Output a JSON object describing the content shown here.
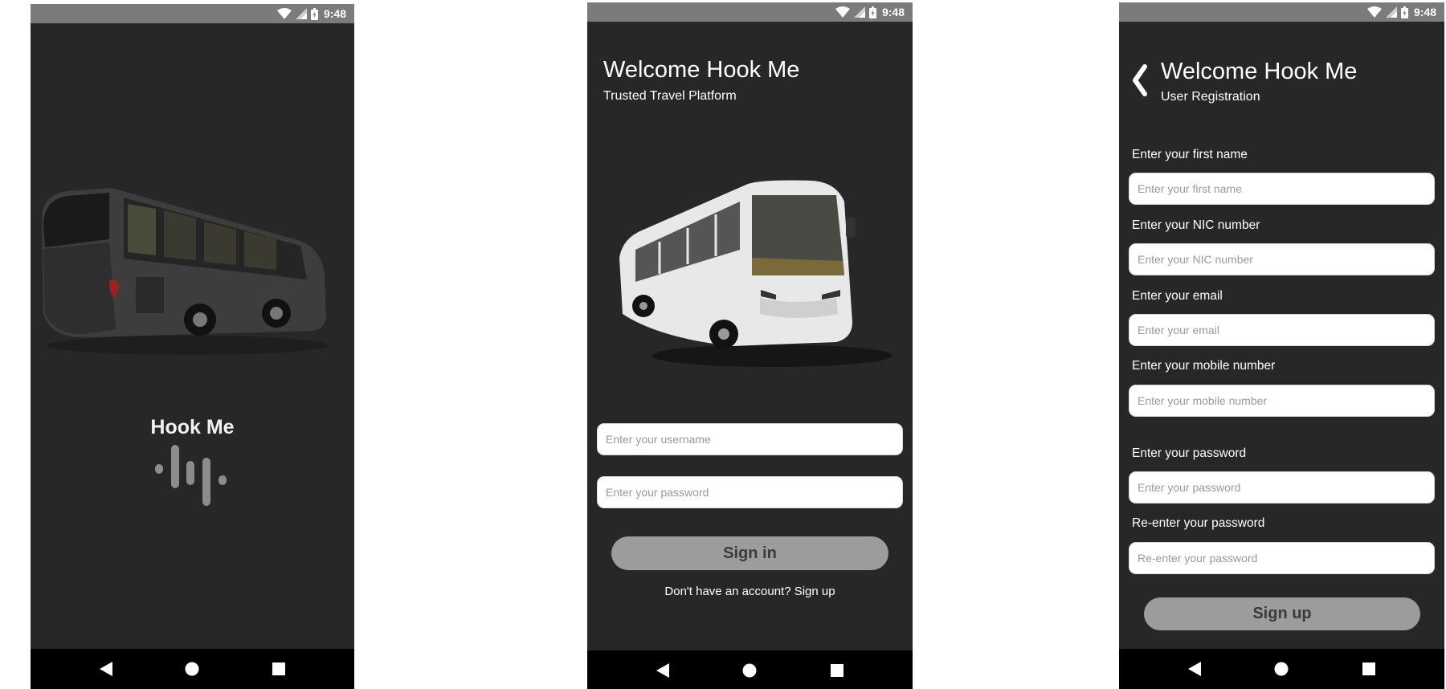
{
  "status_bar": {
    "time": "9:48"
  },
  "screens": {
    "splash": {
      "title": "Hook Me"
    },
    "login": {
      "title": "Welcome Hook Me",
      "subtitle": "Trusted Travel Platform",
      "username_placeholder": "Enter your username",
      "password_placeholder": "Enter your password",
      "sign_in_label": "Sign in",
      "signup_prompt": "Don't have an account? Sign up"
    },
    "register": {
      "title": "Welcome Hook Me",
      "subtitle": "User Registration",
      "fields": [
        {
          "label": "Enter your first name",
          "placeholder": "Enter your first name"
        },
        {
          "label": "Enter your NIC number",
          "placeholder": "Enter your NIC number"
        },
        {
          "label": "Enter your email",
          "placeholder": "Enter your email"
        },
        {
          "label": "Enter your mobile number",
          "placeholder": "Enter your mobile number"
        },
        {
          "label": "Enter your password",
          "placeholder": "Enter your password"
        },
        {
          "label": "Re-enter your password",
          "placeholder": "Re-enter your password"
        }
      ],
      "sign_up_label": "Sign up"
    }
  },
  "icons": {
    "status": [
      "wifi-icon",
      "signal-icon",
      "battery-icon"
    ],
    "nav": [
      "back-triangle-icon",
      "home-circle-icon",
      "recents-square-icon"
    ],
    "splash": "voice-wave-icon",
    "register_back": "chevron-left-icon"
  },
  "colors": {
    "screen_bg": "#272727",
    "status_bar": "#7b7b7b",
    "nav_bar": "#000000",
    "button_bg": "#9c9c9c",
    "button_text": "#3a3a3a"
  }
}
